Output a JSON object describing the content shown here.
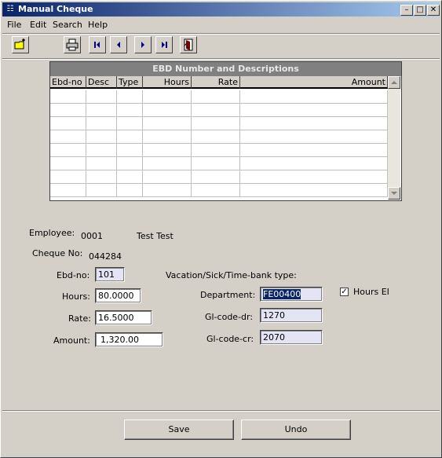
{
  "window": {
    "title": "Manual Cheque"
  },
  "menu": {
    "file": "File",
    "edit": "Edit",
    "search": "Search",
    "help": "Help"
  },
  "grid": {
    "title": "EBD Number and Descriptions",
    "columns": [
      "Ebd-no",
      "Desc",
      "Type",
      "Hours",
      "Rate",
      "Amount"
    ],
    "rows": []
  },
  "employee": {
    "label": "Employee:",
    "number": "0001",
    "name": "Test Test"
  },
  "cheque": {
    "label": "Cheque No:",
    "value": "044284"
  },
  "form": {
    "ebd_label": "Ebd-no:",
    "ebd_value": "101",
    "hours_label": "Hours:",
    "hours_value": "80.0000",
    "rate_label": "Rate:",
    "rate_value": "16.5000",
    "amount_label": "Amount:",
    "amount_value": "1,320.00",
    "vacation_label": "Vacation/Sick/Time-bank type:",
    "department_label": "Department:",
    "department_value": "FE00400",
    "gl_dr_label": "Gl-code-dr:",
    "gl_dr_value": "1270",
    "gl_cr_label": "Gl-code-cr:",
    "gl_cr_value": "2070",
    "hours_ei_label": "Hours EI",
    "hours_ei_checked": true
  },
  "buttons": {
    "save": "Save",
    "undo": "Undo"
  }
}
